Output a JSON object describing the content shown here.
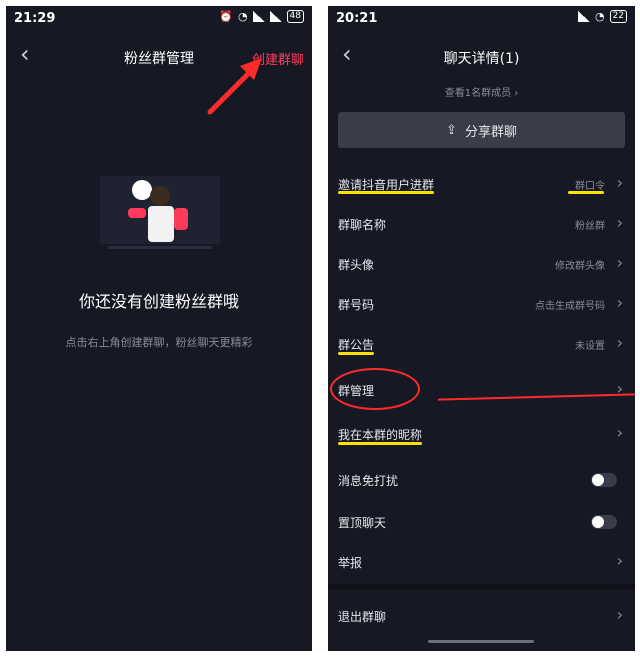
{
  "left": {
    "status": {
      "time": "21:29",
      "battery": "48"
    },
    "nav": {
      "back": "‹",
      "title": "粉丝群管理",
      "create": "创建群聊"
    },
    "empty": {
      "title": "你还没有创建粉丝群哦",
      "subtitle": "点击右上角创建群聊，粉丝聊天更精彩"
    }
  },
  "right": {
    "status": {
      "time": "20:21",
      "battery": "22"
    },
    "nav": {
      "back": "‹",
      "title": "聊天详情(1)"
    },
    "view_members": "查看1名群成员 ›",
    "share": "分享群聊",
    "rows": [
      {
        "label": "邀请抖音用户进群",
        "value": "群口令"
      },
      {
        "label": "群聊名称",
        "value": "粉丝群"
      },
      {
        "label": "群头像",
        "value": "修改群头像"
      },
      {
        "label": "群号码",
        "value": "点击生成群号码"
      },
      {
        "label": "群公告",
        "value": "未设置"
      },
      {
        "label": "群管理",
        "value": ""
      },
      {
        "label": "我在本群的昵称",
        "value": ""
      },
      {
        "label": "消息免打扰",
        "value": ""
      },
      {
        "label": "置顶聊天",
        "value": ""
      },
      {
        "label": "举报",
        "value": ""
      },
      {
        "label": "退出群聊",
        "value": ""
      }
    ]
  },
  "colors": {
    "bg": "#161824",
    "accent_red": "#ff3b5c",
    "highlight_yellow": "#ffe100",
    "annotation_red": "#ff2a2a"
  }
}
